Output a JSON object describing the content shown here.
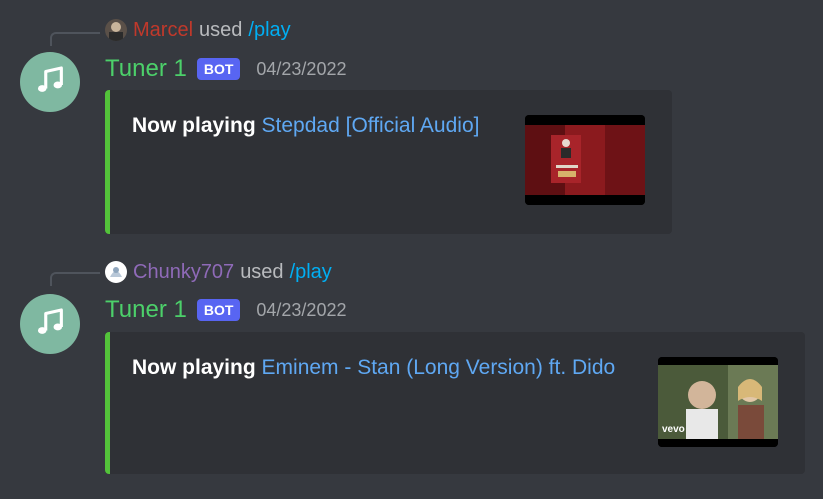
{
  "messages": [
    {
      "reply": {
        "user": "Marcel",
        "used": "used",
        "command": "/play",
        "user_color": "#c0392b"
      },
      "author": "Tuner 1",
      "tag": "BOT",
      "timestamp": "04/23/2022",
      "embed": {
        "label": "Now playing",
        "track": "Stepdad [Official Audio]"
      }
    },
    {
      "reply": {
        "user": "Chunky707",
        "used": "used",
        "command": "/play",
        "user_color": "#8f6ab8"
      },
      "author": "Tuner 1",
      "tag": "BOT",
      "timestamp": "04/23/2022",
      "embed": {
        "label": "Now playing",
        "track": "Eminem - Stan (Long Version) ft. Dido",
        "thumb_watermark": "vevo"
      }
    }
  ],
  "icons": {
    "avatar": "music-note-icon"
  },
  "colors": {
    "background": "#36393f",
    "embed_bg": "#2f3136",
    "embed_border": "#53c33a",
    "bot_name": "#4cd06a",
    "bot_tag": "#5865f2",
    "link": "#5fa8f3"
  }
}
